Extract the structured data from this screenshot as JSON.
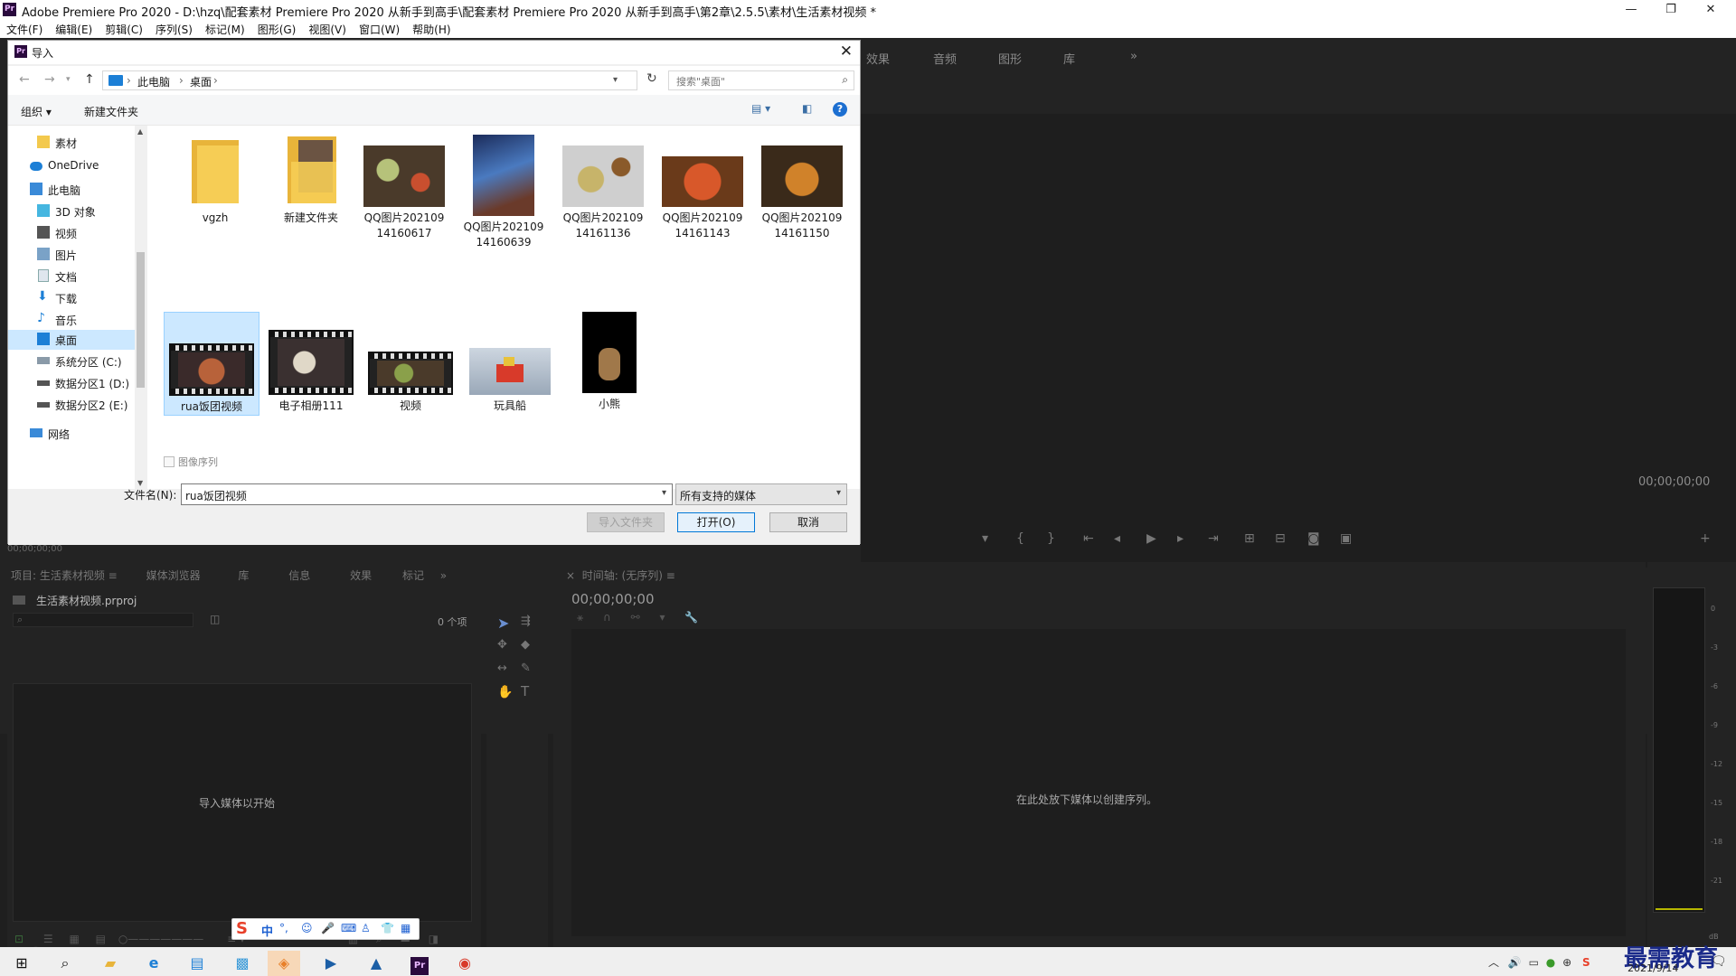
{
  "window": {
    "title": "Adobe Premiere Pro 2020 - D:\\hzq\\配套素材 Premiere Pro 2020 从新手到高手\\配套素材 Premiere Pro 2020 从新手到高手\\第2章\\2.5.5\\素材\\生活素材视频 *",
    "app_icon": "Pr"
  },
  "menu": [
    "文件(F)",
    "编辑(E)",
    "剪辑(C)",
    "序列(S)",
    "标记(M)",
    "图形(G)",
    "视图(V)",
    "窗口(W)",
    "帮助(H)"
  ],
  "workspace_tabs": [
    "效果",
    "音频",
    "图形",
    "库"
  ],
  "workspace_more": "»",
  "program_monitor": {
    "timecode": "00;00;00;00"
  },
  "source_monitor": {
    "timecode": "00;00;00;00"
  },
  "project_panel": {
    "tabs": [
      "项目: 生活素材视频",
      "媒体浏览器",
      "库",
      "信息",
      "效果",
      "标记"
    ],
    "project_file": "生活素材视频.prproj",
    "item_count": "0 个项",
    "empty_text": "导入媒体以开始"
  },
  "timeline_panel": {
    "title": "时间轴: (无序列)",
    "timecode": "00;00;00;00",
    "empty_text": "在此处放下媒体以创建序列。"
  },
  "audio_meter": {
    "labels": [
      "0",
      "-3",
      "-6",
      "-9",
      "-12",
      "-15",
      "-18",
      "-21",
      "dB"
    ]
  },
  "dialog": {
    "title": "导入",
    "icon": "Pr",
    "breadcrumb": [
      "此电脑",
      "桌面"
    ],
    "search_placeholder": "搜索\"桌面\"",
    "toolbar": {
      "organize": "组织 ▾",
      "new_folder": "新建文件夹"
    },
    "nav_items": [
      {
        "label": "素材",
        "icon": "folder-icon"
      },
      {
        "label": "OneDrive",
        "icon": "cloud-icon"
      },
      {
        "label": "此电脑",
        "icon": "computer-icon"
      },
      {
        "label": "3D 对象",
        "icon": "cube-icon"
      },
      {
        "label": "视频",
        "icon": "video-icon"
      },
      {
        "label": "图片",
        "icon": "picture-icon"
      },
      {
        "label": "文档",
        "icon": "document-icon"
      },
      {
        "label": "下载",
        "icon": "download-icon"
      },
      {
        "label": "音乐",
        "icon": "music-icon"
      },
      {
        "label": "桌面",
        "icon": "desktop-icon",
        "selected": true
      },
      {
        "label": "系统分区 (C:)",
        "icon": "drive-icon"
      },
      {
        "label": "数据分区1 (D:)",
        "icon": "drive-icon"
      },
      {
        "label": "数据分区2 (E:)",
        "icon": "drive-icon"
      },
      {
        "label": "网络",
        "icon": "network-icon"
      }
    ],
    "files": [
      {
        "name": "vgzh",
        "type": "folder"
      },
      {
        "name": "新建文件夹",
        "type": "folder-photo"
      },
      {
        "name": "QQ图片20210914160617",
        "type": "image"
      },
      {
        "name": "QQ图片20210914160639",
        "type": "image"
      },
      {
        "name": "QQ图片20210914161136",
        "type": "image"
      },
      {
        "name": "QQ图片20210914161143",
        "type": "image"
      },
      {
        "name": "QQ图片20210914161150",
        "type": "image"
      },
      {
        "name": "rua饭团视频",
        "type": "video",
        "selected": true
      },
      {
        "name": "电子相册111",
        "type": "video"
      },
      {
        "name": "视频",
        "type": "video"
      },
      {
        "name": "玩具船",
        "type": "image"
      },
      {
        "name": "小熊",
        "type": "image"
      }
    ],
    "image_sequence": "图像序列",
    "filename_label": "文件名(N):",
    "filename_value": "rua饭团视频",
    "filetype_value": "所有支持的媒体",
    "buttons": {
      "import_folder": "导入文件夹",
      "open": "打开(O)",
      "cancel": "取消"
    }
  },
  "taskbar": {
    "clock_date": "2021/9/14",
    "watermark": "最需教育",
    "ime_mode": "中"
  }
}
